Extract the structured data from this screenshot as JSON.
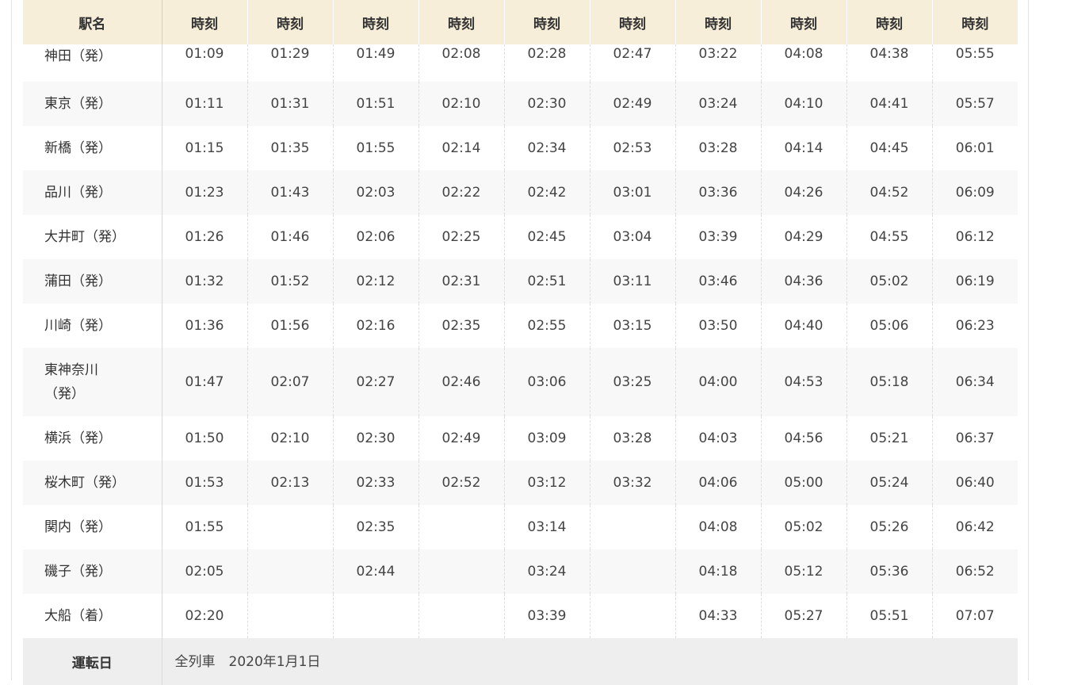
{
  "table": {
    "headers": {
      "station": "駅名",
      "time": [
        "時刻",
        "時刻",
        "時刻",
        "時刻",
        "時刻",
        "時刻",
        "時刻",
        "時刻",
        "時刻",
        "時刻"
      ]
    },
    "rows": [
      {
        "station": "神田（発）",
        "times": [
          "01:09",
          "01:29",
          "01:49",
          "02:08",
          "02:28",
          "02:47",
          "03:22",
          "04:08",
          "04:38",
          "05:55"
        ]
      },
      {
        "station": "東京（発）",
        "times": [
          "01:11",
          "01:31",
          "01:51",
          "02:10",
          "02:30",
          "02:49",
          "03:24",
          "04:10",
          "04:41",
          "05:57"
        ]
      },
      {
        "station": "新橋（発）",
        "times": [
          "01:15",
          "01:35",
          "01:55",
          "02:14",
          "02:34",
          "02:53",
          "03:28",
          "04:14",
          "04:45",
          "06:01"
        ]
      },
      {
        "station": "品川（発）",
        "times": [
          "01:23",
          "01:43",
          "02:03",
          "02:22",
          "02:42",
          "03:01",
          "03:36",
          "04:26",
          "04:52",
          "06:09"
        ]
      },
      {
        "station": "大井町（発）",
        "times": [
          "01:26",
          "01:46",
          "02:06",
          "02:25",
          "02:45",
          "03:04",
          "03:39",
          "04:29",
          "04:55",
          "06:12"
        ]
      },
      {
        "station": "蒲田（発）",
        "times": [
          "01:32",
          "01:52",
          "02:12",
          "02:31",
          "02:51",
          "03:11",
          "03:46",
          "04:36",
          "05:02",
          "06:19"
        ]
      },
      {
        "station": "川崎（発）",
        "times": [
          "01:36",
          "01:56",
          "02:16",
          "02:35",
          "02:55",
          "03:15",
          "03:50",
          "04:40",
          "05:06",
          "06:23"
        ]
      },
      {
        "station_line1": "東神奈川",
        "station_line2": "（発）",
        "times": [
          "01:47",
          "02:07",
          "02:27",
          "02:46",
          "03:06",
          "03:25",
          "04:00",
          "04:53",
          "05:18",
          "06:34"
        ]
      },
      {
        "station": "横浜（発）",
        "times": [
          "01:50",
          "02:10",
          "02:30",
          "02:49",
          "03:09",
          "03:28",
          "04:03",
          "04:56",
          "05:21",
          "06:37"
        ]
      },
      {
        "station": "桜木町（発）",
        "times": [
          "01:53",
          "02:13",
          "02:33",
          "02:52",
          "03:12",
          "03:32",
          "04:06",
          "05:00",
          "05:24",
          "06:40"
        ]
      },
      {
        "station": "関内（発）",
        "times": [
          "01:55",
          "",
          "02:35",
          "",
          "03:14",
          "",
          "04:08",
          "05:02",
          "05:26",
          "06:42"
        ]
      },
      {
        "station": "磯子（発）",
        "times": [
          "02:05",
          "",
          "02:44",
          "",
          "03:24",
          "",
          "04:18",
          "05:12",
          "05:36",
          "06:52"
        ]
      },
      {
        "station": "大船（着）",
        "times": [
          "02:20",
          "",
          "",
          "",
          "03:39",
          "",
          "04:33",
          "05:27",
          "05:51",
          "07:07"
        ]
      }
    ],
    "footer": {
      "label": "運転日",
      "value": "全列車　2020年1月1日"
    }
  }
}
